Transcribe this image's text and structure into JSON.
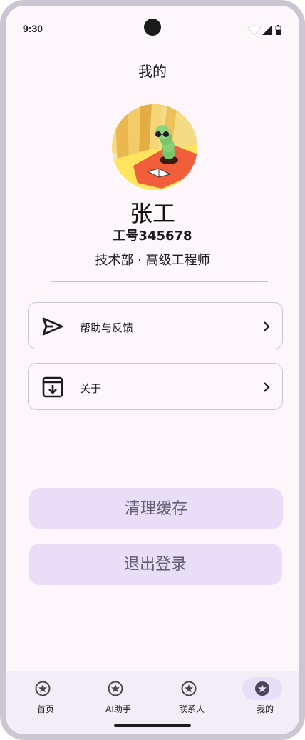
{
  "status_bar": {
    "time": "9:30",
    "icons": [
      "wifi-icon",
      "signal-icon",
      "battery-icon"
    ]
  },
  "header": {
    "title": "我的"
  },
  "profile": {
    "avatar": "avatar-illustration",
    "name": "张工",
    "employee_id": "工号345678",
    "department_title": "技术部 · 高级工程师"
  },
  "menu": [
    {
      "icon": "send-icon",
      "label": "帮助与反馈"
    },
    {
      "icon": "archive-icon",
      "label": "关于"
    }
  ],
  "actions": {
    "clear_cache": "清理缓存",
    "logout": "退出登录"
  },
  "bottom_nav": {
    "items": [
      {
        "icon": "star-circle-icon",
        "label": "首页",
        "active": false
      },
      {
        "icon": "star-circle-icon",
        "label": "AI助手",
        "active": false
      },
      {
        "icon": "star-circle-icon",
        "label": "联系人",
        "active": false
      },
      {
        "icon": "star-circle-icon",
        "label": "我的",
        "active": true
      }
    ]
  },
  "colors": {
    "background": "#fdf7fc",
    "button_fill": "#e8def8",
    "button_text": "#625b71",
    "nav_background": "#f3edf6",
    "card_border": "#cac4d0"
  }
}
